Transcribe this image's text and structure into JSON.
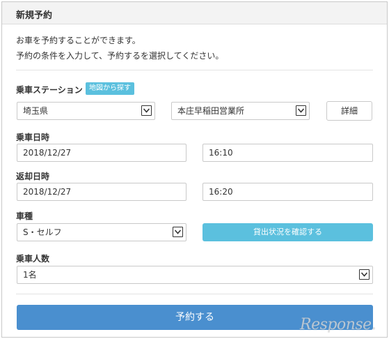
{
  "panel": {
    "title": "新規予約"
  },
  "intro": {
    "line1": "お車を予約することができます。",
    "line2": "予約の条件を入力して、予約するを選択してください。"
  },
  "station": {
    "label": "乗車ステーション",
    "map_button": "地図から探す",
    "prefecture": "埼玉県",
    "office": "本庄早稲田営業所",
    "detail_button": "詳細"
  },
  "pickup": {
    "label": "乗車日時",
    "date": "2018/12/27",
    "time": "16:10"
  },
  "return": {
    "label": "返却日時",
    "date": "2018/12/27",
    "time": "16:20"
  },
  "vehicle": {
    "label": "車種",
    "value": "S・セルフ",
    "availability_button": "貸出状況を確認する"
  },
  "passengers": {
    "label": "乗車人数",
    "value": "1名"
  },
  "submit_button": "予約する",
  "watermark": "Response.",
  "colors": {
    "info": "#5bc0de",
    "primary": "#4a8fcf",
    "header_bg": "#f3f3f3"
  }
}
